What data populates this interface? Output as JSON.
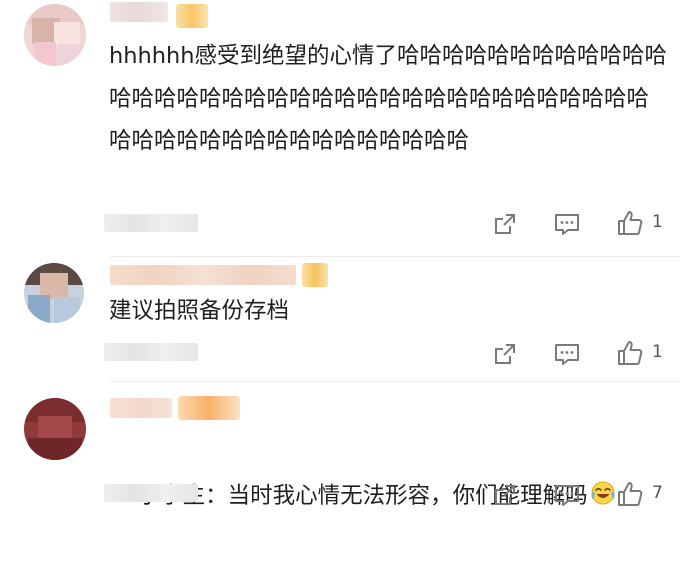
{
  "comments": [
    {
      "text": "hhhhhh感受到绝望的心情了哈哈哈哈哈哈哈哈哈哈哈哈哈哈哈哈哈哈哈哈哈哈哈哈哈哈哈哈哈哈哈哈哈哈哈哈哈哈哈哈哈哈哈哈哈哈哈哈哈哈哈哈",
      "like_count": "1"
    },
    {
      "text": "建议拍照备份存档",
      "like_count": "1"
    },
    {
      "text": "小学生：当时我心情无法形容，你们能理解吗",
      "like_count": "7",
      "emoji": "laughing-crying-emoji"
    }
  ],
  "icons": {
    "share": "share-icon",
    "comment": "comment-icon",
    "like": "thumbs-up-icon"
  },
  "colors": {
    "icon": "#7a7a7a",
    "divider": "#ececec",
    "text": "#1f1f1f"
  }
}
